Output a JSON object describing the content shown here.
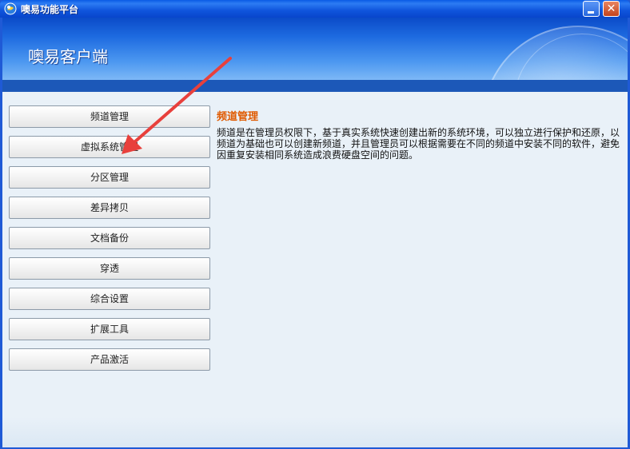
{
  "window": {
    "title": "噢易功能平台",
    "icon": "app-logo-icon",
    "controls": {
      "minimize": "minimize-icon",
      "close_label": "✕"
    }
  },
  "banner": {
    "title": "噢易客户端"
  },
  "menu": {
    "items": [
      {
        "label": "频道管理"
      },
      {
        "label": "虚拟系统管理"
      },
      {
        "label": "分区管理"
      },
      {
        "label": "差异拷贝"
      },
      {
        "label": "文档备份"
      },
      {
        "label": "穿透"
      },
      {
        "label": "综合设置"
      },
      {
        "label": "扩展工具"
      },
      {
        "label": "产品激活"
      }
    ]
  },
  "content": {
    "title": "频道管理",
    "description": "频道是在管理员权限下，基于真实系统快速创建出新的系统环境，可以独立进行保护和还原，以频道为基础也可以创建新频道，并且管理员可以根据需要在不同的频道中安装不同的软件，避免因重复安装相同系统造成浪费硬盘空间的问题。"
  },
  "annotation": {
    "arrow_color": "#e8403c"
  }
}
